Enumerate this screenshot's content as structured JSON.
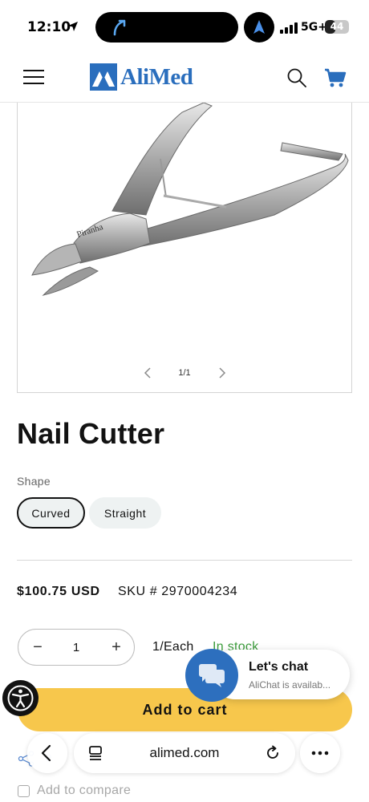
{
  "status_bar": {
    "time": "12:10",
    "network": "5G+",
    "battery": "44",
    "battery_level": 0.44
  },
  "header": {
    "logo_text": "AliMed",
    "brand_color": "#2a6ebd"
  },
  "gallery": {
    "counter": "1/1"
  },
  "product": {
    "title": "Nail Cutter",
    "shape_label": "Shape",
    "shapes": [
      {
        "label": "Curved",
        "selected": true
      },
      {
        "label": "Straight",
        "selected": false
      }
    ],
    "price": "$100.75 USD",
    "sku": "SKU # 2970004234",
    "quantity": "1",
    "qty_minus": "−",
    "qty_plus": "+",
    "unit": "1/Each",
    "stock": "In stock",
    "add_to_cart": "Add to cart",
    "share_fragment": "e",
    "compare_label": "Add to compare"
  },
  "chat": {
    "title": "Let's chat",
    "subtitle": "AliChat is availab..."
  },
  "safari": {
    "url": "alimed.com"
  },
  "colors": {
    "accent": "#2a6ebd",
    "cart_button": "#f7c74c",
    "in_stock": "#3a9b3a",
    "chat": "#2d6fbe"
  }
}
